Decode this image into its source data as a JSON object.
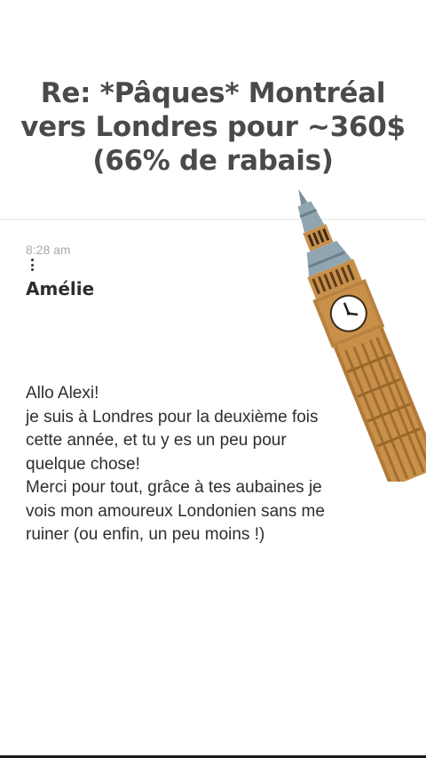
{
  "post": {
    "title_lines": [
      "Re: *Pâques* Montréal",
      "vers Londres pour ~360$",
      "(66% de rabais)"
    ],
    "time": "8:28 am",
    "sender": "Amélie",
    "message_lines": [
      "Allo Alexi!",
      "je suis à Londres pour la deuxième fois",
      "cette année, et tu y es un peu pour",
      "quelque chose!",
      "Merci pour tout, grâce à tes aubaines je",
      "vois mon amoureux Londonien sans me",
      "ruiner (ou enfin, un peu moins !)"
    ]
  },
  "illustration": {
    "icon": "big-ben-icon",
    "colors": {
      "stone": "#c9904a",
      "roof": "#8fa6b2",
      "clock": "#ffffff"
    }
  }
}
